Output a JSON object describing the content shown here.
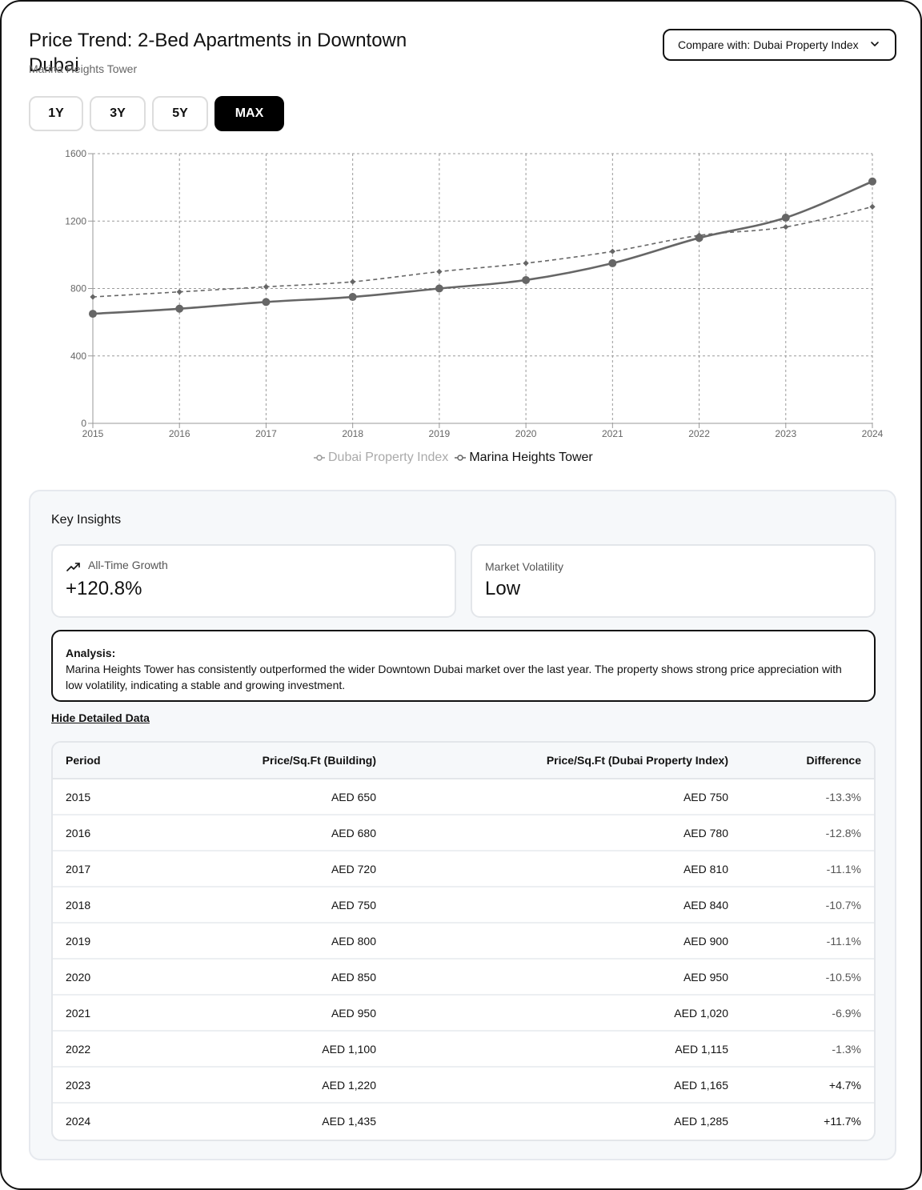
{
  "header": {
    "title": "Price Trend: 2-Bed Apartments in Downtown Dubai",
    "subtitle": "Marina Heights Tower",
    "compare_label": "Compare with: Dubai Property Index"
  },
  "ranges": [
    {
      "label": "1Y",
      "active": false
    },
    {
      "label": "3Y",
      "active": false
    },
    {
      "label": "5Y",
      "active": false
    },
    {
      "label": "MAX",
      "active": true
    }
  ],
  "chart_data": {
    "type": "line",
    "x": [
      "2015",
      "2016",
      "2017",
      "2018",
      "2019",
      "2020",
      "2021",
      "2022",
      "2023",
      "2024"
    ],
    "series": [
      {
        "name": "Dubai Property Index",
        "values": [
          750,
          780,
          810,
          840,
          900,
          950,
          1020,
          1115,
          1165,
          1285
        ],
        "style": "dashed",
        "marker": "diamond",
        "active": false
      },
      {
        "name": "Marina Heights Tower",
        "values": [
          650,
          680,
          720,
          750,
          800,
          850,
          950,
          1100,
          1220,
          1435
        ],
        "style": "solid",
        "marker": "circle",
        "active": true
      }
    ],
    "yticks": [
      "0",
      "400",
      "800",
      "1200",
      "1600"
    ],
    "ylim": [
      0,
      1600
    ],
    "grid": true,
    "legend": "bottom",
    "colors": {
      "line": "#666666",
      "grid": "#9a9a9a"
    }
  },
  "insights": {
    "title": "Key Insights",
    "growth_label": "All-Time Growth",
    "growth_value": "+120.8%",
    "volatility_label": "Market Volatility",
    "volatility_value": "Low",
    "analysis_head": "Analysis:",
    "analysis_text": "Marina Heights Tower has consistently outperformed the wider Downtown Dubai market over the last year. The property shows strong price appreciation with low volatility, indicating a stable and growing investment.",
    "toggle_label": "Hide Detailed Data"
  },
  "table": {
    "headers": [
      "Period",
      "Price/Sq.Ft (Building)",
      "Price/Sq.Ft (Dubai Property Index)",
      "Difference"
    ],
    "rows": [
      [
        "2015",
        "AED 650",
        "AED 750",
        "-13.3%"
      ],
      [
        "2016",
        "AED 680",
        "AED 780",
        "-12.8%"
      ],
      [
        "2017",
        "AED 720",
        "AED 810",
        "-11.1%"
      ],
      [
        "2018",
        "AED 750",
        "AED 840",
        "-10.7%"
      ],
      [
        "2019",
        "AED 800",
        "AED 900",
        "-11.1%"
      ],
      [
        "2020",
        "AED 850",
        "AED 950",
        "-10.5%"
      ],
      [
        "2021",
        "AED 950",
        "AED 1,020",
        "-6.9%"
      ],
      [
        "2022",
        "AED 1,100",
        "AED 1,115",
        "-1.3%"
      ],
      [
        "2023",
        "AED 1,220",
        "AED 1,165",
        "+4.7%"
      ],
      [
        "2024",
        "AED 1,435",
        "AED 1,285",
        "+11.7%"
      ]
    ]
  }
}
